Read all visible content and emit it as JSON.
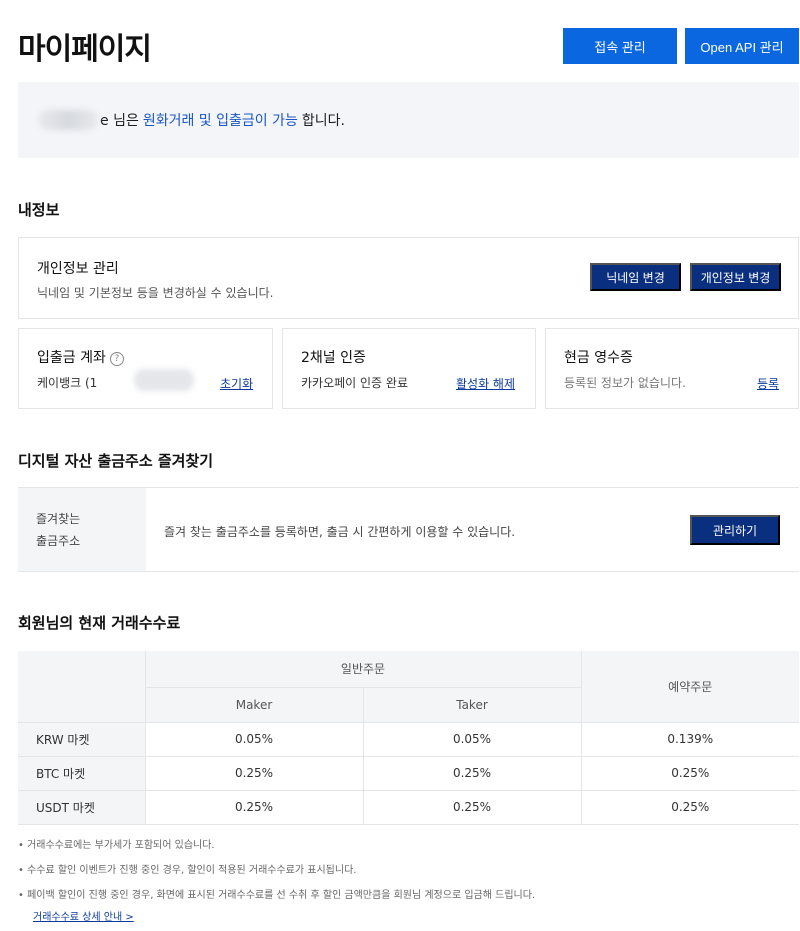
{
  "header": {
    "title": "마이페이지",
    "access_button": "접속 관리",
    "api_button": "Open API 관리"
  },
  "status": {
    "suffix": "e 님은",
    "link": "원화거래 및 입출금이 가능",
    "end": "합니다."
  },
  "my_info": {
    "section_title": "내정보",
    "privacy": {
      "title": "개인정보 관리",
      "desc": "닉네임 및 기본정보 등을 변경하실 수 있습니다.",
      "nickname_button": "닉네임 변경",
      "info_button": "개인정보 변경"
    },
    "deposit_account": {
      "title": "입출금 계좌",
      "help": "?",
      "value": "케이뱅크 (1",
      "action": "초기화"
    },
    "two_channel": {
      "title": "2채널 인증",
      "value": "카카오페이 인증 완료",
      "action": "활성화 해제"
    },
    "cash_receipt": {
      "title": "현금 영수증",
      "value": "등록된 정보가 없습니다.",
      "action": "등록"
    }
  },
  "favorites": {
    "section_title": "디지털 자산 출금주소 즐겨찾기",
    "label": "즐겨찾는\n출금주소",
    "desc": "즐겨 찾는 출금주소를 등록하면, 출금 시 간편하게 이용할 수 있습니다.",
    "button": "관리하기"
  },
  "fees": {
    "section_title": "회원님의 현재 거래수수료",
    "header_general": "일반주문",
    "header_maker": "Maker",
    "header_taker": "Taker",
    "header_reserved": "예약주문",
    "rows": [
      {
        "market": "KRW 마켓",
        "maker": "0.05%",
        "taker": "0.05%",
        "reserved": "0.139%"
      },
      {
        "market": "BTC 마켓",
        "maker": "0.25%",
        "taker": "0.25%",
        "reserved": "0.25%"
      },
      {
        "market": "USDT 마켓",
        "maker": "0.25%",
        "taker": "0.25%",
        "reserved": "0.25%"
      }
    ],
    "notes": [
      "• 거래수수료에는 부가세가 포함되어 있습니다.",
      "• 수수료 할인 이벤트가 진행 중인 경우, 할인이 적용된 거래수수료가 표시됩니다.",
      "• 페이백 할인이 진행 중인 경우, 화면에 표시된 거래수수료를 선 수취 후 할인 금액만큼을 회원님 계정으로 입금해 드립니다."
    ],
    "detail_link": "거래수수료 상세 안내 >"
  },
  "colors": {
    "primary": "#0a67e0",
    "navy": "#0b2f7f",
    "link": "#1a56c2",
    "panel": "#f3f5f8"
  }
}
